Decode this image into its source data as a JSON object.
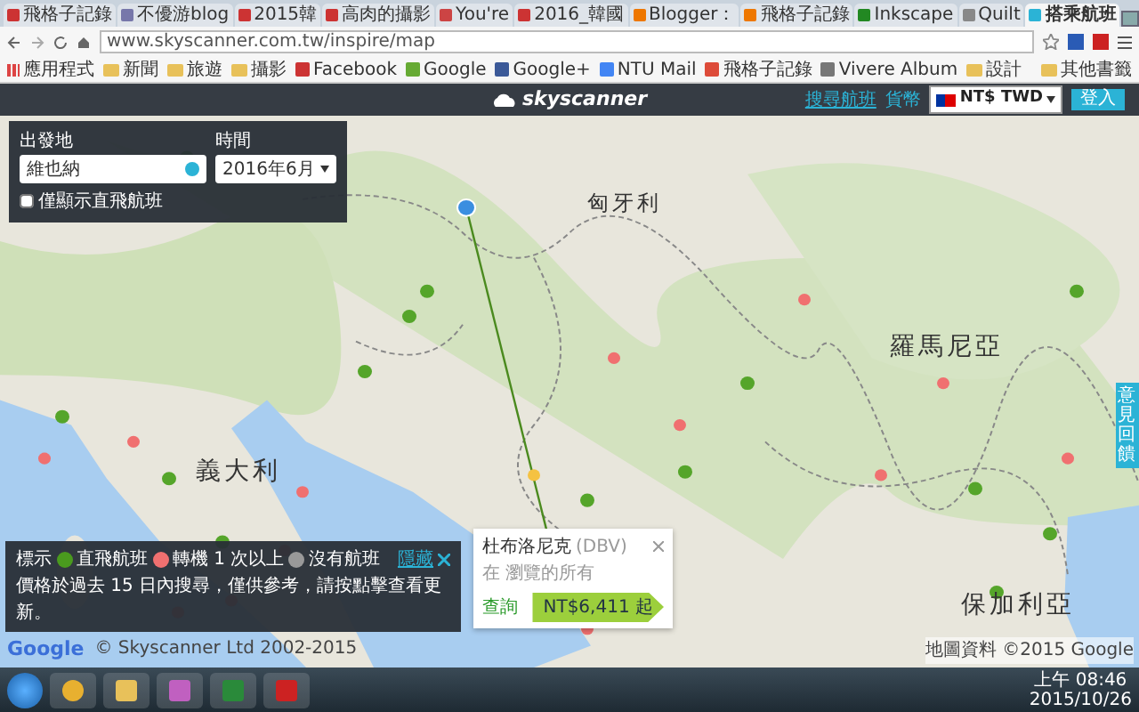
{
  "browser": {
    "tabs": [
      {
        "title": "飛格子記錄",
        "selected": false
      },
      {
        "title": "不優游blog",
        "selected": false
      },
      {
        "title": "2015韓",
        "selected": false
      },
      {
        "title": "高肉的攝影",
        "selected": false
      },
      {
        "title": "You're",
        "selected": false
      },
      {
        "title": "2016_韓國",
        "selected": false
      },
      {
        "title": "Blogger：",
        "selected": false
      },
      {
        "title": "飛格子記錄",
        "selected": false
      },
      {
        "title": "Inkscape",
        "selected": false
      },
      {
        "title": "Quilt",
        "selected": false
      },
      {
        "title": "搭乘航班",
        "selected": true
      }
    ],
    "address": "www.skyscanner.com.tw/inspire/map",
    "bookmarks": [
      {
        "label": "應用程式",
        "kind": "apps"
      },
      {
        "label": "新聞",
        "kind": "folder"
      },
      {
        "label": "旅遊",
        "kind": "folder"
      },
      {
        "label": "攝影",
        "kind": "folder"
      },
      {
        "label": "Facebook",
        "kind": "site"
      },
      {
        "label": "Google",
        "kind": "site"
      },
      {
        "label": "Google+",
        "kind": "site"
      },
      {
        "label": "NTU Mail",
        "kind": "site"
      },
      {
        "label": "飛格子記錄",
        "kind": "site"
      },
      {
        "label": "Vivere Album",
        "kind": "site"
      },
      {
        "label": "設計",
        "kind": "folder"
      },
      {
        "label": "其他書籤",
        "kind": "folder"
      }
    ]
  },
  "header": {
    "logo": "skyscanner",
    "search_flights": "搜尋航班",
    "currency_label": "貨幣",
    "currency": "NT$ TWD",
    "login": "登入"
  },
  "search_panel": {
    "origin_label": "出發地",
    "origin": "維也納",
    "date_label": "時間",
    "date": "2016年6月",
    "direct_only": {
      "label": "僅顯示直飛航班",
      "checked": false
    }
  },
  "map": {
    "country_labels": [
      "匈牙利",
      "羅馬尼亞",
      "義大利",
      "保加利亞"
    ],
    "feedback_tab": "意見回饋",
    "google": "Google",
    "attribution": "© Skyscanner Ltd 2002-2015",
    "map_data": "地圖資料 ©2015 Google"
  },
  "popup": {
    "title": "杜布洛尼克",
    "code": "(DBV)",
    "subtitle": "在 瀏覽的所有",
    "link": "查詢",
    "price": "NT$6,411 起"
  },
  "legend": {
    "title": "標示",
    "items": [
      {
        "label": "直飛航班",
        "color": "#4a9a1e"
      },
      {
        "label": "轉機 1 次以上",
        "color": "#f07070"
      },
      {
        "label": "沒有航班",
        "color": "#999999"
      }
    ],
    "hide": "隱藏",
    "note": "價格於過去 15 日內搜尋，僅供參考，請按點擊查看更新。"
  },
  "taskbar": {
    "time": "上午 08:46",
    "date": "2015/10/26"
  }
}
